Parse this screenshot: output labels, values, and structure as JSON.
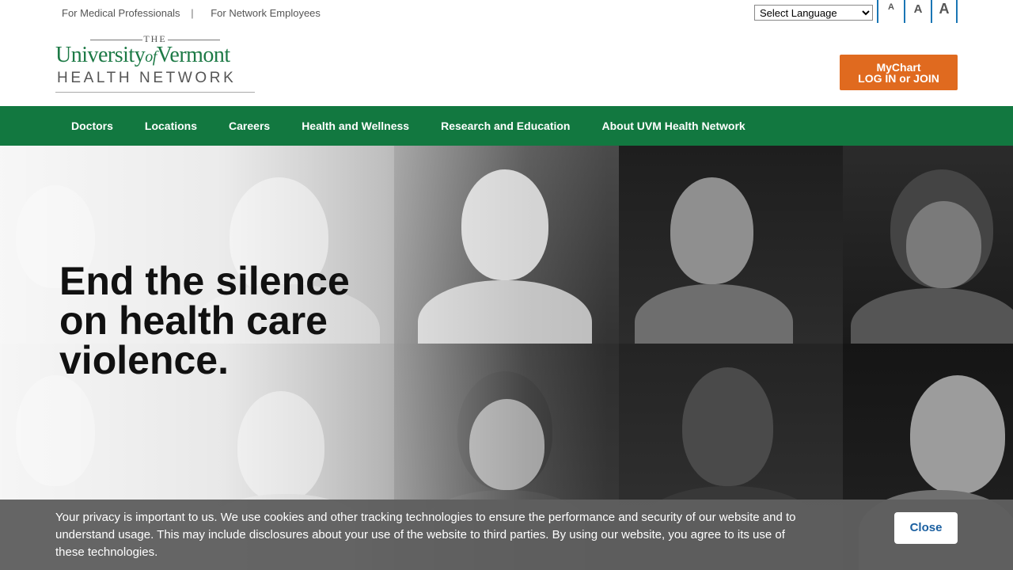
{
  "utility": {
    "links": [
      "For Medical Professionals",
      "For Network Employees"
    ],
    "separator": "|",
    "language_select": "Select Language",
    "font_sizes": [
      "A",
      "A",
      "A"
    ]
  },
  "logo": {
    "the": "THE",
    "university": "University",
    "of": "of",
    "vermont": "Vermont",
    "network": "HEALTH NETWORK"
  },
  "mychart": {
    "line1": "MyChart",
    "line2": "LOG IN or JOIN",
    "color": "#e06a1f"
  },
  "nav": {
    "color": "#127840",
    "items": [
      "Doctors",
      "Locations",
      "Careers",
      "Health and Wellness",
      "Research and Education",
      "About UVM Health Network"
    ]
  },
  "hero": {
    "title": "End the silence on health care violence."
  },
  "cookie": {
    "text": "Your privacy is important to us. We use cookies and other tracking technologies to ensure the performance and security of our website and to understand usage. This may include disclosures about your use of the website to third parties. By using our website, you agree to its use of these technologies.",
    "close_label": "Close"
  }
}
